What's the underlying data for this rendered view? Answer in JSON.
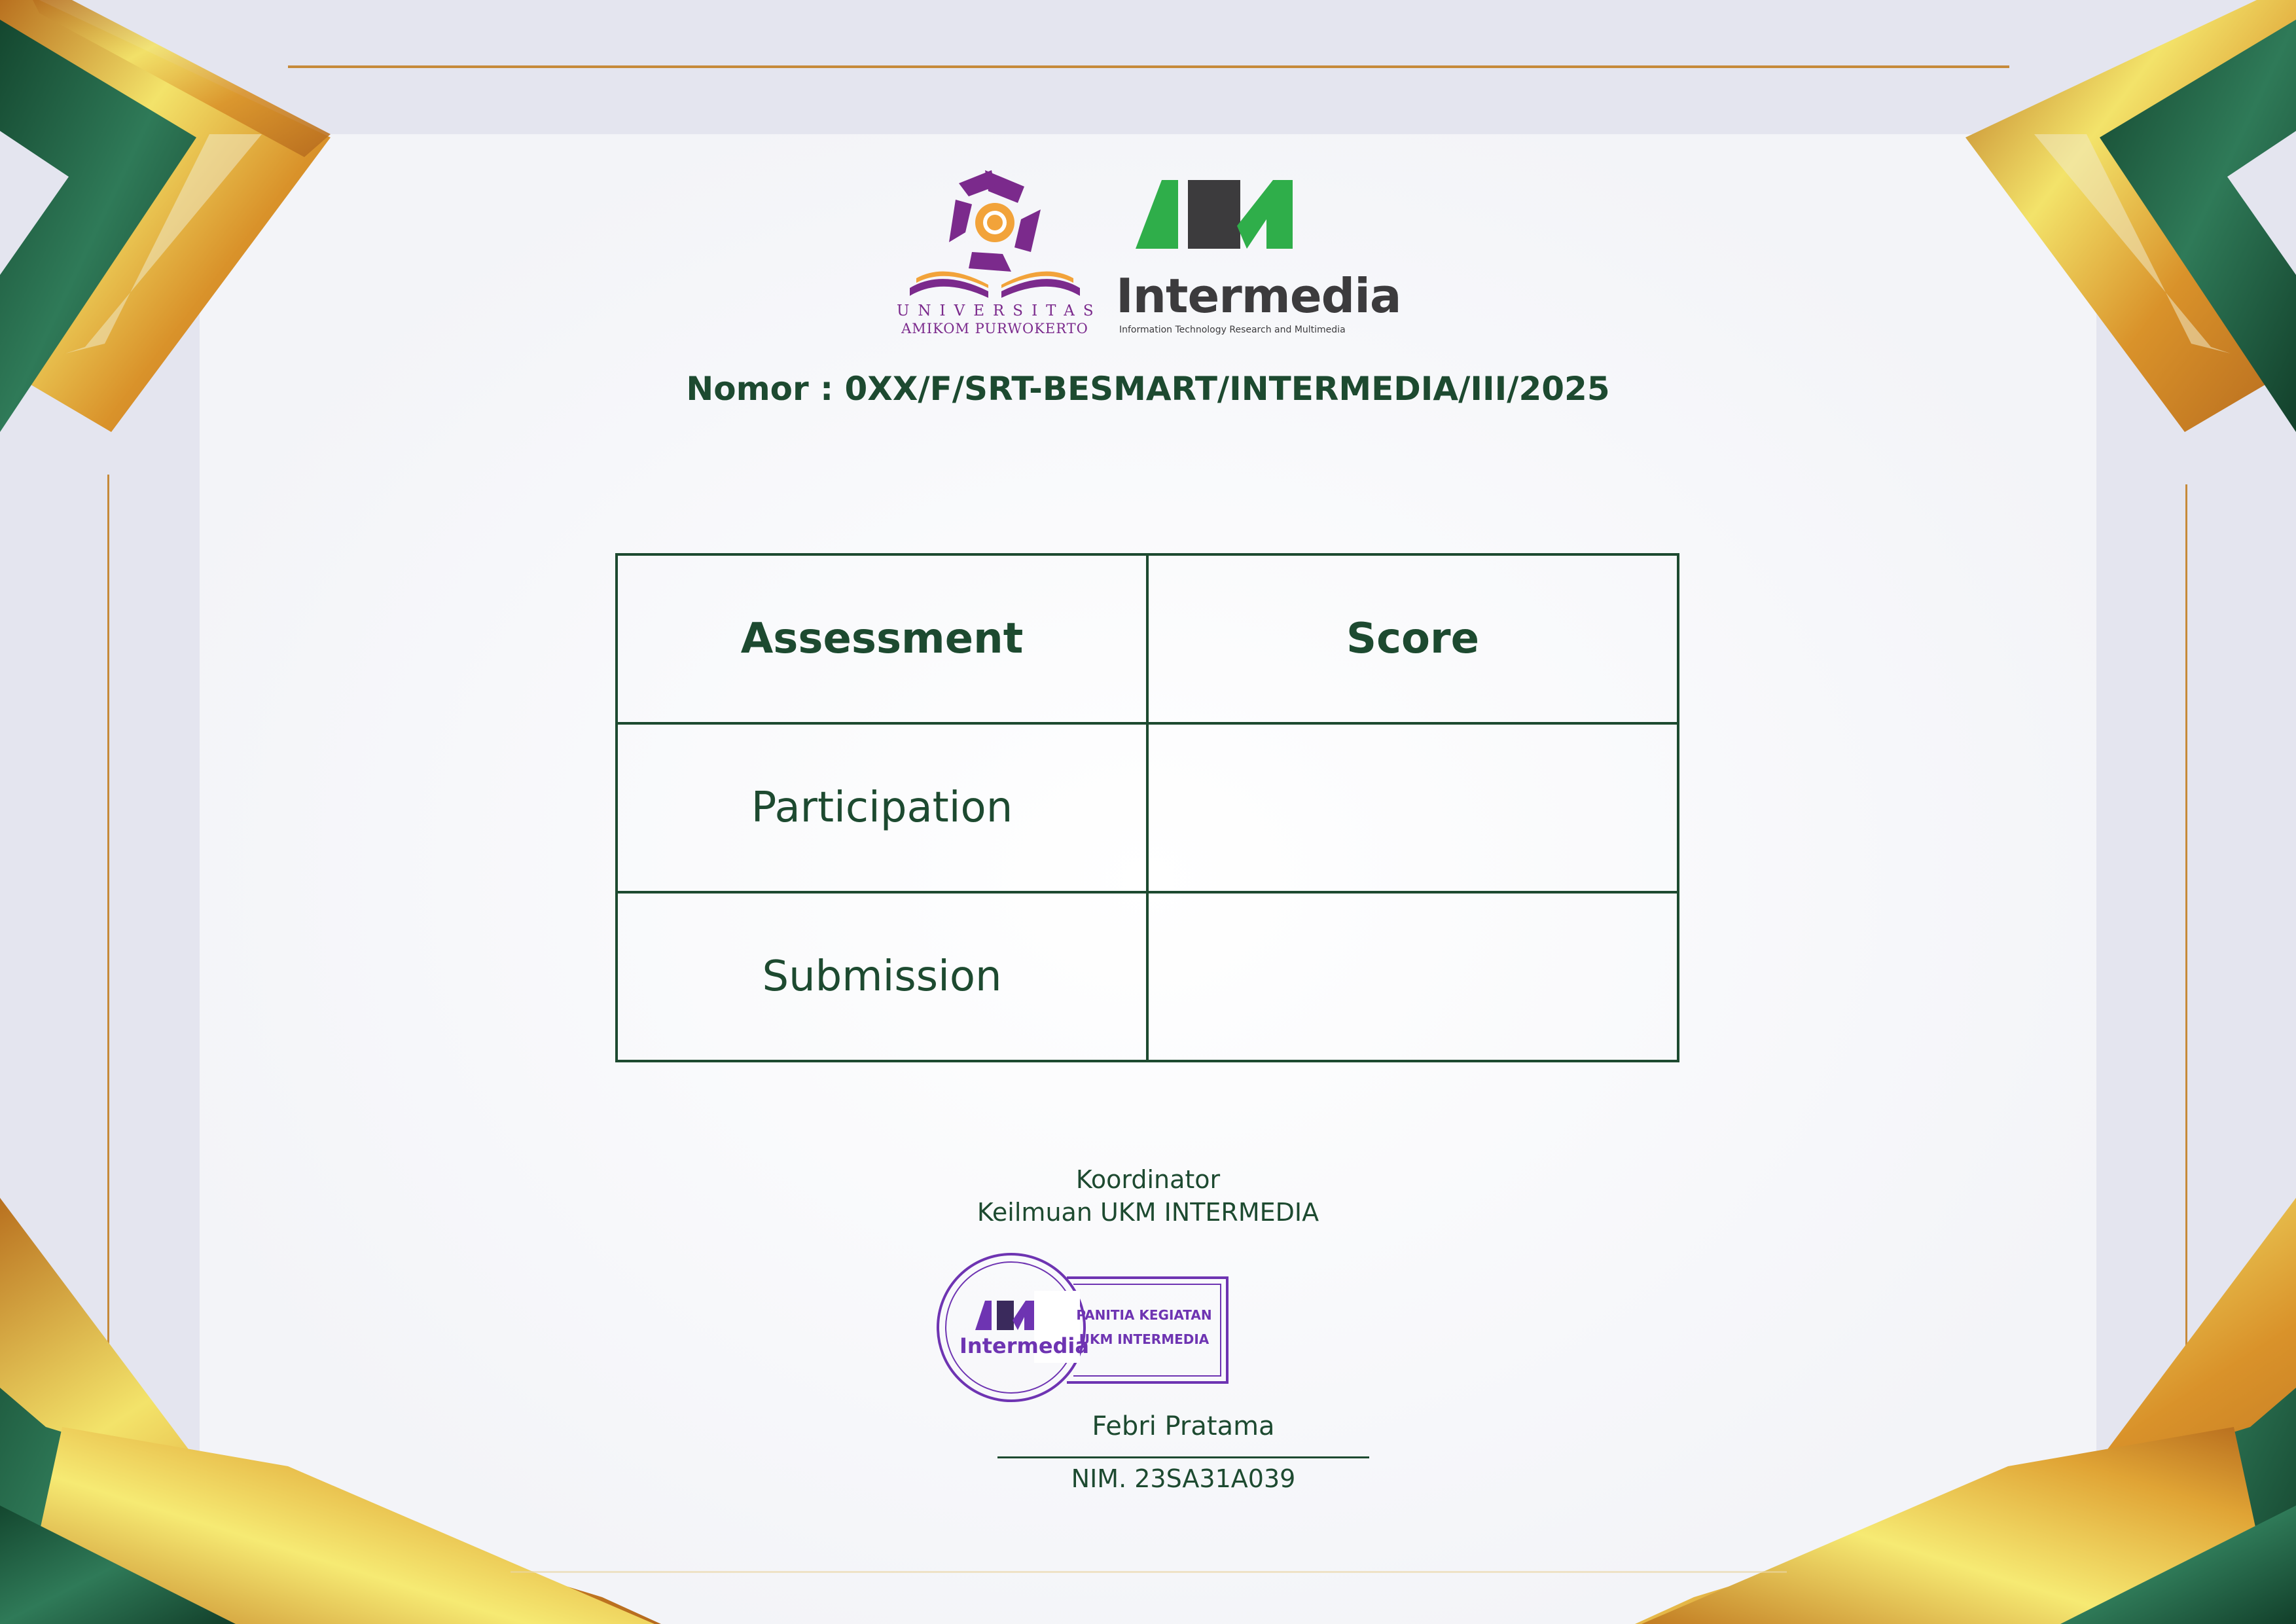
{
  "document": {
    "number": "Nomor : 0XX/F/SRT-BESMART/INTERMEDIA/III/2025"
  },
  "logos": {
    "university_line1": "UNIVERSITAS",
    "university_line2": "AMIKOM PURWOKERTO",
    "intermedia_wordmark": "Intermedia",
    "intermedia_tagline": "Information Technology Research and Multimedia"
  },
  "table": {
    "headers": [
      "Assessment",
      "Score"
    ],
    "rows": [
      [
        "Participation",
        ""
      ],
      [
        "Submission",
        ""
      ]
    ]
  },
  "signature": {
    "role_line1": "Koordinator",
    "role_line2": "Keilmuan UKM INTERMEDIA",
    "stamp_wordmark": "Intermedia",
    "stamp_line1": "PANITIA KEGIATAN",
    "stamp_line2": "UKM INTERMEDIA",
    "name": "Febri Pratama",
    "id": "NIM. 23SA31A039"
  },
  "colors": {
    "text": "#1d4a30",
    "frame_green": "#1e5b3f",
    "gold": "#d9a33a",
    "purple": "#6e34b2"
  }
}
